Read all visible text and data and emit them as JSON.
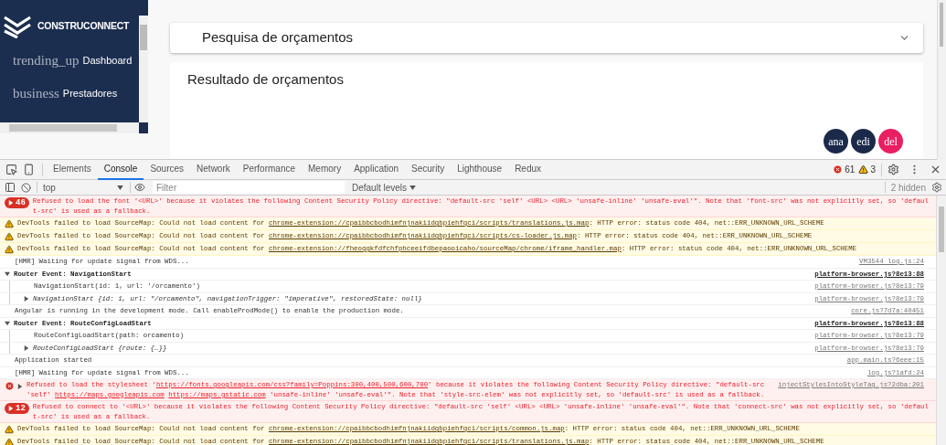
{
  "sidebar": {
    "logo_text": "CONSTRUCONNECT",
    "items": [
      {
        "icon_text": "trending_up",
        "label": "Dashboard"
      },
      {
        "icon_text": "business",
        "label": "Prestadores"
      }
    ]
  },
  "search_panel": {
    "title": "Pesquisa de orçamentos",
    "expanded": false
  },
  "results_panel": {
    "title": "Resultado de orçamentos",
    "actions": [
      {
        "label": "ana",
        "color": "#1b2a4a"
      },
      {
        "label": "edi",
        "color": "#1b2a4a"
      },
      {
        "label": "del",
        "color": "#e91e63"
      }
    ]
  },
  "devtools": {
    "tabs": [
      {
        "label": "Elements",
        "selected": false
      },
      {
        "label": "Console",
        "selected": true
      },
      {
        "label": "Sources",
        "selected": false
      },
      {
        "label": "Network",
        "selected": false
      },
      {
        "label": "Performance",
        "selected": false
      },
      {
        "label": "Memory",
        "selected": false
      },
      {
        "label": "Application",
        "selected": false
      },
      {
        "label": "Security",
        "selected": false
      },
      {
        "label": "Lighthouse",
        "selected": false
      },
      {
        "label": "Redux",
        "selected": false
      }
    ],
    "error_count": "61",
    "warning_count": "3",
    "toolbar": {
      "context": "top",
      "filter_placeholder": "Filter",
      "levels": "Default levels",
      "hidden": "2 hidden"
    },
    "messages": [
      {
        "kind": "error",
        "badge": "46",
        "parts": [
          {
            "kind": "text",
            "text": "Refused to load the font '<URL>' because it violates the following Content Security Policy directive: \"default-src 'self' <URL> <URL> 'unsafe-inline' 'unsafe-eval'\". Note that 'font-src' was not explicitly set, so 'default-src' is used as a fallback."
          }
        ]
      },
      {
        "kind": "warning",
        "parts": [
          {
            "kind": "text",
            "text": "DevTools failed to load SourceMap: Could not load content for "
          },
          {
            "kind": "link",
            "text": "chrome-extension://cpaibbcbodhimfnjnakiidgbpiehfgci/scripts/translations.js.map"
          },
          {
            "kind": "text",
            "text": ": HTTP error: status code 404, net::ERR_UNKNOWN_URL_SCHEME"
          }
        ]
      },
      {
        "kind": "warning",
        "parts": [
          {
            "kind": "text",
            "text": "DevTools failed to load SourceMap: Could not load content for "
          },
          {
            "kind": "link",
            "text": "chrome-extension://cpaibbcbodhimfnjnakiidgbpiehfgci/scripts/cs-loader.js.map"
          },
          {
            "kind": "text",
            "text": ": HTTP error: status code 404, net::ERR_UNKNOWN_URL_SCHEME"
          }
        ]
      },
      {
        "kind": "warning",
        "parts": [
          {
            "kind": "text",
            "text": "DevTools failed to load SourceMap: Could not load content for "
          },
          {
            "kind": "link",
            "text": "chrome-extension://fheoggkfdfchfphceeifdbepaooicaho/sourceMap/chrome/iframe_handler.map"
          },
          {
            "kind": "text",
            "text": ": HTTP error: status code 404, net::ERR_UNKNOWN_URL_SCHEME"
          }
        ]
      },
      {
        "kind": "log",
        "parts": [
          {
            "kind": "text",
            "text": "[HMR] Waiting for update signal from WDS..."
          }
        ],
        "source": "VM3544 log.js:24"
      },
      {
        "kind": "group",
        "expanded": true,
        "parts": [
          {
            "kind": "text",
            "text": "Router Event: NavigationStart"
          }
        ],
        "source": "platform-browser.js?8e13:88",
        "children": [
          {
            "kind": "log",
            "parts": [
              {
                "kind": "text",
                "text": "NavigationStart(id: 1, url: '/orcamento')"
              }
            ],
            "source": "platform-browser.js?8e13:79"
          },
          {
            "kind": "object",
            "expanded": false,
            "parts": [
              {
                "kind": "text",
                "text": "NavigationStart {id: 1, url: \"/orcamento\", navigationTrigger: \"imperative\", restoredState: null}"
              }
            ],
            "source": "platform-browser.js?8e13:79"
          }
        ]
      },
      {
        "kind": "log",
        "parts": [
          {
            "kind": "text",
            "text": "Angular is running in the development mode. Call enableProdMode() to enable the production mode."
          }
        ],
        "source": "core.js?7d7a:40451"
      },
      {
        "kind": "group",
        "expanded": true,
        "parts": [
          {
            "kind": "text",
            "text": "Router Event: RouteConfigLoadStart"
          }
        ],
        "source": "platform-browser.js?8e13:88",
        "children": [
          {
            "kind": "log",
            "parts": [
              {
                "kind": "text",
                "text": "RouteConfigLoadStart(path: orcamento)"
              }
            ],
            "source": "platform-browser.js?8e13:79"
          },
          {
            "kind": "object",
            "expanded": false,
            "parts": [
              {
                "kind": "text",
                "text": "RouteConfigLoadStart {route: {…}}"
              }
            ],
            "source": "platform-browser.js?8e13:79"
          }
        ]
      },
      {
        "kind": "log",
        "parts": [
          {
            "kind": "text",
            "text": "Application started"
          }
        ],
        "source": "app.main.ts?6eee:15"
      },
      {
        "kind": "log",
        "parts": [
          {
            "kind": "text",
            "text": "[HMR] Waiting for update signal from WDS..."
          }
        ],
        "source": "log.js?1afd:24"
      },
      {
        "kind": "error",
        "expanded": false,
        "parts": [
          {
            "kind": "text",
            "text": "Refused to load the stylesheet '"
          },
          {
            "kind": "link",
            "text": "https://fonts.googleapis.com/css?family=Poppins:300,400,500,600,700"
          },
          {
            "kind": "text",
            "text": "' because it violates the following Content Security Policy directive: \"default-src 'self' "
          },
          {
            "kind": "link",
            "text": "https://maps.googleapis.com"
          },
          {
            "kind": "link",
            "text": "https://maps.gstatic.com"
          },
          {
            "kind": "text",
            "text": " 'unsafe-inline' 'unsafe-eval'\". Note that 'style-src-elem' was not explicitly set, so 'default-src' is used as a fallback."
          }
        ],
        "source": "injectStylesIntoStyleTag.js?2dba:201"
      },
      {
        "kind": "error",
        "badge": "12",
        "parts": [
          {
            "kind": "text",
            "text": "Refused to connect to '<URL>' because it violates the following Content Security Policy directive: \"default-src 'self' <URL> <URL> 'unsafe-inline' 'unsafe-eval'\". Note that 'connect-src' was not explicitly set, so 'default-src' is used as a fallback."
          }
        ]
      },
      {
        "kind": "warning",
        "parts": [
          {
            "kind": "text",
            "text": "DevTools failed to load SourceMap: Could not load content for "
          },
          {
            "kind": "link",
            "text": "chrome-extension://cpaibbcbodhimfnjnakiidgbpiehfgci/scripts/common.js.map"
          },
          {
            "kind": "text",
            "text": ": HTTP error: status code 404, net::ERR_UNKNOWN_URL_SCHEME"
          }
        ]
      },
      {
        "kind": "warning",
        "parts": [
          {
            "kind": "text",
            "text": "DevTools failed to load SourceMap: Could not load content for "
          },
          {
            "kind": "link",
            "text": "chrome-extension://cpaibbcbodhimfnjnakiidgbpiehfgci/scripts/translations.js.map"
          },
          {
            "kind": "text",
            "text": ": HTTP error: status code 404, net::ERR_UNKNOWN_URL_SCHEME"
          }
        ]
      }
    ]
  }
}
